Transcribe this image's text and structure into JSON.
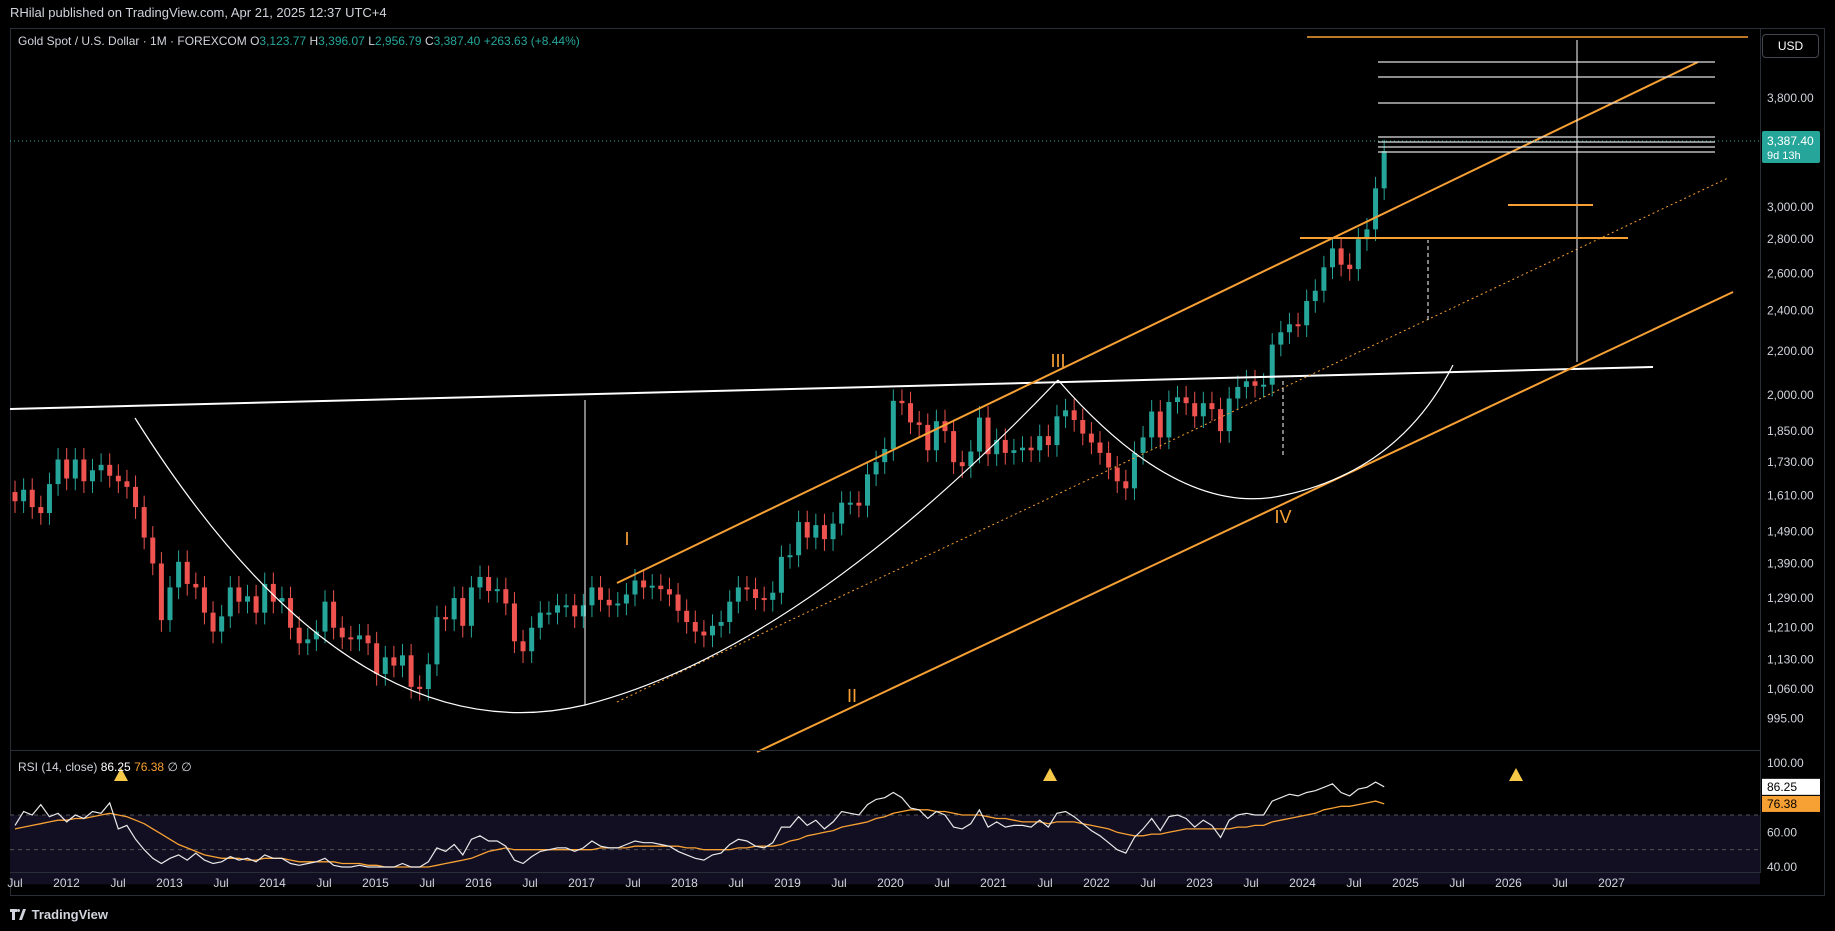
{
  "header": {
    "publish_line": "RHilal published on TradingView.com, Apr 21, 2025 12:37 UTC+4"
  },
  "legend": {
    "symbol": "Gold Spot / U.S. Dollar · 1M · FOREXCOM",
    "o_label": "O",
    "o_value": "3,123.77",
    "h_label": "H",
    "h_value": "3,396.07",
    "l_label": "L",
    "l_value": "2,956.79",
    "c_label": "C",
    "c_value": "3,387.40",
    "change": "+263.63 (+8.44%)"
  },
  "currency_button": "USD",
  "price_tag": {
    "value": "3,387.40",
    "countdown": "9d 13h"
  },
  "rsi_legend": {
    "name": "RSI (14, close)",
    "rsi": "86.25",
    "ma": "76.38",
    "x1": "∅",
    "x2": "∅"
  },
  "rsi_tags": {
    "rsi": "86.25",
    "ma": "76.38"
  },
  "footer": {
    "brand": "TradingView"
  },
  "colors": {
    "up": "#26a69a",
    "down": "#ef5350",
    "orange": "#f7a034",
    "background": "#000000"
  },
  "chart_data": [
    {
      "type": "candlestick",
      "title": "Gold Spot / U.S. Dollar · 1M · FOREXCOM",
      "y_axis": {
        "scale": "log",
        "ylim": [
          960,
          4200
        ],
        "tick_labels": [
          "3,800.00",
          "3,000.00",
          "2,800.00",
          "2,600.00",
          "2,400.00",
          "2,200.00",
          "2,000.00",
          "1,850.00",
          "1,730.00",
          "1,610.00",
          "1,490.00",
          "1,390.00",
          "1,290.00",
          "1,210.00",
          "1,130.00",
          "1,060.00",
          "995.00"
        ]
      },
      "x_axis": {
        "tick_labels": [
          "Jul",
          "2012",
          "Jul",
          "2013",
          "Jul",
          "2014",
          "Jul",
          "2015",
          "Jul",
          "2016",
          "Jul",
          "2017",
          "Jul",
          "2018",
          "Jul",
          "2019",
          "Jul",
          "2020",
          "Jul",
          "2021",
          "Jul",
          "2022",
          "Jul",
          "2023",
          "Jul",
          "2024",
          "Jul",
          "2025",
          "Jul",
          "2026",
          "Jul",
          "2027"
        ]
      },
      "wave_labels": [
        "I",
        "II",
        "III",
        "IV"
      ],
      "closes": [
        1590,
        1630,
        1570,
        1550,
        1650,
        1740,
        1670,
        1740,
        1660,
        1700,
        1720,
        1680,
        1660,
        1640,
        1570,
        1470,
        1390,
        1230,
        1320,
        1395,
        1330,
        1320,
        1250,
        1200,
        1240,
        1320,
        1280,
        1295,
        1250,
        1330,
        1280,
        1290,
        1210,
        1170,
        1180,
        1200,
        1280,
        1210,
        1185,
        1180,
        1190,
        1170,
        1095,
        1135,
        1115,
        1140,
        1065,
        1060,
        1118,
        1238,
        1232,
        1290,
        1215,
        1320,
        1350,
        1310,
        1315,
        1275,
        1175,
        1150,
        1210,
        1250,
        1250,
        1270,
        1270,
        1240,
        1270,
        1320,
        1285,
        1270,
        1275,
        1300,
        1340,
        1320,
        1325,
        1315,
        1300,
        1255,
        1225,
        1200,
        1190,
        1215,
        1225,
        1280,
        1320,
        1315,
        1290,
        1285,
        1305,
        1410,
        1415,
        1520,
        1470,
        1510,
        1465,
        1515,
        1585,
        1585,
        1575,
        1685,
        1730,
        1780,
        1975,
        1965,
        1885,
        1875,
        1775,
        1890,
        1850,
        1730,
        1715,
        1770,
        1905,
        1760,
        1815,
        1765,
        1775,
        1785,
        1775,
        1830,
        1795,
        1910,
        1935,
        1895,
        1840,
        1805,
        1765,
        1710,
        1660,
        1635,
        1765,
        1825,
        1930,
        1825,
        1970,
        1990,
        1965,
        1910,
        1965,
        1940,
        1850,
        1985,
        2035,
        2060,
        2040,
        2045,
        2230,
        2290,
        2330,
        2325,
        2450,
        2505,
        2635,
        2745,
        2650,
        2625,
        2800,
        2860,
        3125,
        3387
      ]
    },
    {
      "type": "line",
      "title": "RSI (14, close)",
      "ylim": [
        40,
        100
      ],
      "tick_labels": [
        "100.00",
        "60.00",
        "40.00"
      ],
      "series": [
        {
          "name": "RSI",
          "values": [
            64,
            72,
            70,
            76,
            69,
            71,
            66,
            70,
            68,
            72,
            71,
            77,
            62,
            64,
            56,
            50,
            45,
            42,
            45,
            47,
            44,
            48,
            44,
            42,
            43,
            46,
            44,
            45,
            43,
            47,
            45,
            45,
            42,
            41,
            42,
            43,
            45,
            41,
            40,
            40,
            41,
            40,
            38,
            40,
            39,
            42,
            38,
            37,
            43,
            51,
            49,
            53,
            47,
            56,
            58,
            55,
            55,
            52,
            44,
            42,
            46,
            49,
            50,
            51,
            51,
            49,
            51,
            55,
            52,
            51,
            51,
            53,
            55,
            54,
            54,
            53,
            52,
            49,
            47,
            45,
            44,
            47,
            48,
            53,
            56,
            55,
            52,
            51,
            54,
            63,
            63,
            69,
            64,
            67,
            62,
            66,
            72,
            71,
            70,
            76,
            79,
            80,
            83,
            80,
            74,
            73,
            68,
            72,
            70,
            63,
            62,
            65,
            73,
            63,
            66,
            63,
            64,
            64,
            63,
            67,
            63,
            71,
            72,
            69,
            65,
            61,
            58,
            54,
            50,
            48,
            57,
            62,
            68,
            61,
            69,
            70,
            68,
            63,
            67,
            64,
            57,
            67,
            70,
            71,
            70,
            70,
            78,
            80,
            82,
            81,
            83,
            84,
            86,
            88,
            83,
            81,
            85,
            86,
            89,
            86.25
          ]
        },
        {
          "name": "MA",
          "values": [
            62,
            63,
            64,
            65,
            66,
            67,
            67,
            68,
            68,
            69,
            70,
            71,
            70,
            69,
            67,
            65,
            62,
            59,
            56,
            53,
            51,
            49,
            47,
            46,
            45,
            45,
            45,
            44,
            44,
            45,
            45,
            45,
            44,
            43,
            43,
            43,
            43,
            43,
            42,
            42,
            42,
            41,
            41,
            40,
            40,
            40,
            40,
            40,
            40,
            41,
            42,
            43,
            44,
            45,
            47,
            49,
            50,
            51,
            50,
            50,
            50,
            50,
            50,
            50,
            50,
            50,
            50,
            50,
            51,
            51,
            51,
            51,
            52,
            52,
            52,
            52,
            52,
            52,
            51,
            51,
            50,
            50,
            50,
            50,
            51,
            51,
            52,
            52,
            52,
            53,
            55,
            56,
            58,
            59,
            60,
            61,
            63,
            64,
            65,
            66,
            68,
            69,
            71,
            72,
            73,
            73,
            73,
            72,
            72,
            71,
            70,
            70,
            70,
            69,
            68,
            68,
            67,
            66,
            66,
            66,
            65,
            66,
            66,
            66,
            65,
            64,
            63,
            62,
            60,
            59,
            58,
            58,
            59,
            59,
            60,
            61,
            62,
            62,
            62,
            62,
            62,
            62,
            63,
            63,
            64,
            64,
            66,
            67,
            68,
            69,
            70,
            71,
            73,
            74,
            75,
            75,
            76,
            77,
            78,
            76.38
          ]
        }
      ],
      "reference_lines": [
        70,
        50
      ]
    }
  ]
}
